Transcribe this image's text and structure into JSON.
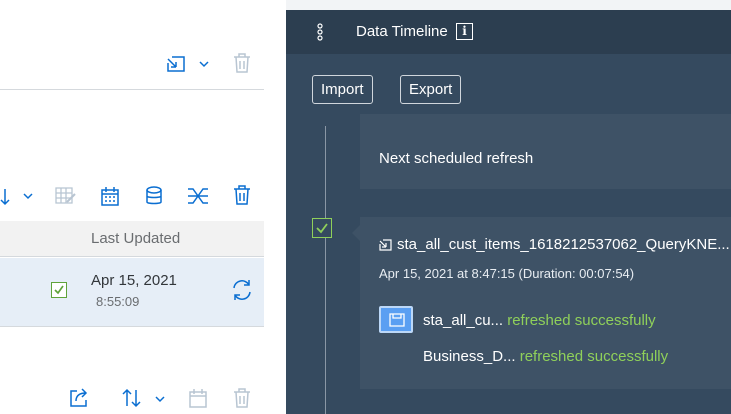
{
  "left_pane": {
    "table": {
      "column_header": "Last Updated",
      "rows": [
        {
          "date": "Apr 15, 2021",
          "time": "8:55:09"
        }
      ]
    }
  },
  "panel": {
    "title": "Data Timeline",
    "info_glyph": "i",
    "buttons": {
      "import": "Import",
      "export": "Export"
    },
    "entries": [
      {
        "label": "Next scheduled refresh"
      },
      {
        "query_name": "sta_all_cust_items_1618212537062_QueryKNE...",
        "timestamp": "Apr 15, 2021 at 8:47:15 (Duration: 00:07:54)",
        "results": [
          {
            "name": "sta_all_cu...",
            "status": "refreshed successfully"
          },
          {
            "name": "Business_D...",
            "status": "refreshed successfully"
          }
        ]
      }
    ]
  },
  "colors": {
    "panel_bg": "#354a5f",
    "panel_header": "#2c3e50",
    "success_green": "#8fd05a",
    "selected_row": "#e6eef7",
    "icon_blue": "#0a6ed1"
  },
  "icons": [
    "import-icon",
    "chevron-down-icon",
    "trash-icon",
    "sort-icon",
    "edit-table-icon",
    "calendar-icon",
    "database-icon",
    "transform-icon",
    "refresh-icon",
    "share-icon",
    "checkbox-icon",
    "info-icon",
    "drag-handle-icon",
    "dataset-icon"
  ]
}
